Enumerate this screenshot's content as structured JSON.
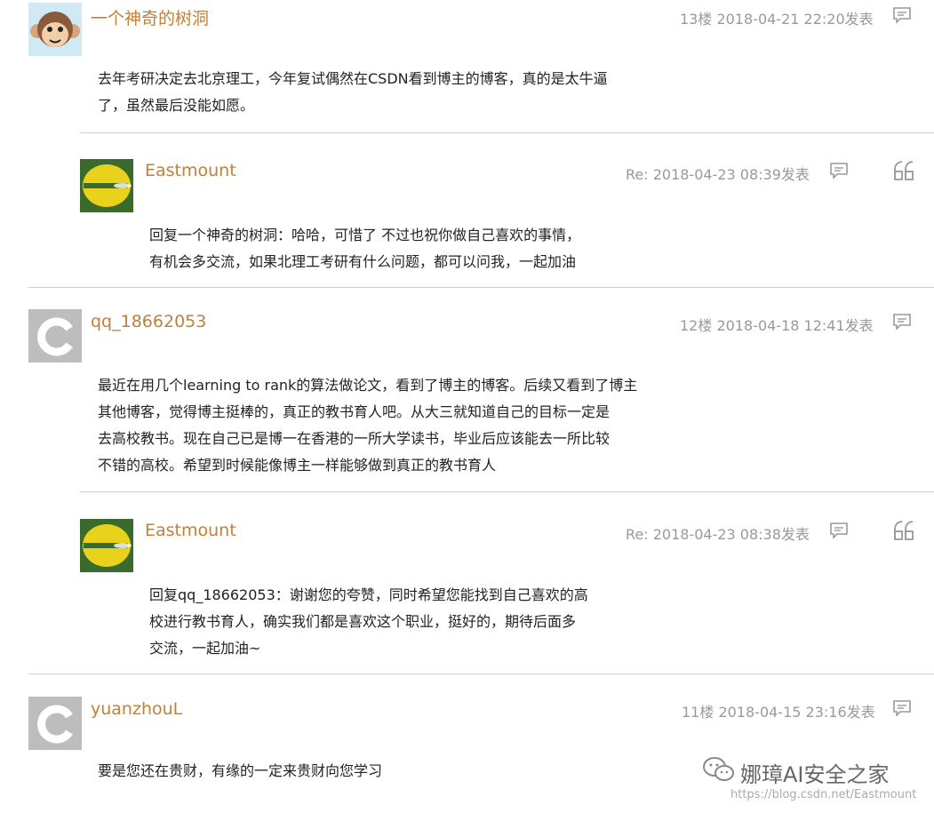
{
  "comments": [
    {
      "username": "一个神奇的树洞",
      "meta": "13楼 2018-04-21 22:20发表",
      "lines": [
        "去年考研决定去北京理工，今年复试偶然在CSDN看到博主的博客，真的是太牛逼",
        "了，虽然最后没能如愿。"
      ],
      "reply": {
        "username": "Eastmount",
        "meta": "Re: 2018-04-23 08:39发表",
        "lines": [
          "回复一个神奇的树洞：哈哈，可惜了 不过也祝你做自己喜欢的事情，",
          "有机会多交流，如果北理工考研有什么问题，都可以问我，一起加油"
        ]
      }
    },
    {
      "username": "qq_18662053",
      "meta": "12楼 2018-04-18 12:41发表",
      "lines": [
        "最近在用几个learning to rank的算法做论文，看到了博主的博客。后续又看到了博主",
        "其他博客，觉得博主挺棒的，真正的教书育人吧。从大三就知道自己的目标一定是",
        "去高校教书。现在自己已是博一在香港的一所大学读书，毕业后应该能去一所比较",
        "不错的高校。希望到时候能像博主一样能够做到真正的教书育人"
      ],
      "reply": {
        "username": "Eastmount",
        "meta": "Re: 2018-04-23 08:38发表",
        "lines": [
          "回复qq_18662053：谢谢您的夸赞，同时希望您能找到自己喜欢的高",
          "校进行教书育人，确实我们都是喜欢这个职业，挺好的，期待后面多",
          "交流，一起加油~"
        ]
      }
    },
    {
      "username": "yuanzhouL",
      "meta": "11楼 2018-04-15 23:16发表",
      "lines": [
        "要是您还在贵财，有缘的一定来贵财向您学习"
      ]
    }
  ],
  "watermark": {
    "name": "娜璋AI安全之家",
    "url": "https://blog.csdn.net/Eastmount"
  },
  "icons": {
    "reply": "comment-bubble-icon",
    "quote": "quote-icon",
    "wechat": "wechat-icon"
  }
}
